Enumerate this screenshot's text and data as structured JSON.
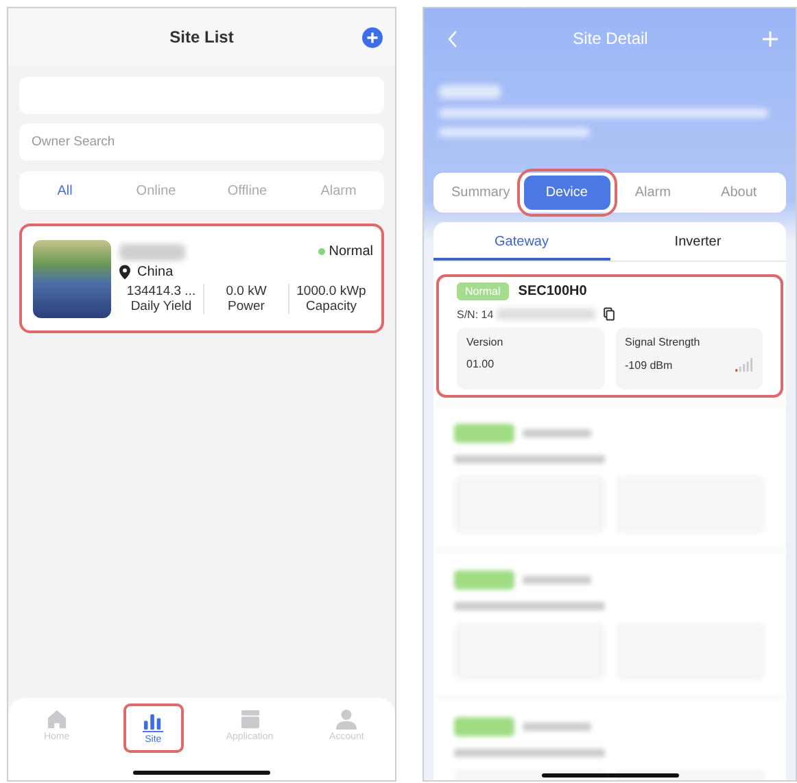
{
  "site_list": {
    "title": "Site List",
    "owner_search": {
      "placeholder": "Owner Search"
    },
    "filters": [
      {
        "label": "All",
        "selected": true
      },
      {
        "label": "Online",
        "selected": false
      },
      {
        "label": "Offline",
        "selected": false
      },
      {
        "label": "Alarm",
        "selected": false
      }
    ],
    "sites": [
      {
        "status": "Normal",
        "color": "#86d67e",
        "location": "China",
        "highlighted": true,
        "stats": [
          {
            "value": "134414.3 ...",
            "label": "Daily Yield"
          },
          {
            "value": "0.0 kW",
            "label": "Power"
          },
          {
            "value": "1000.0 kWp",
            "label": "Capacity"
          }
        ]
      }
    ],
    "nav": [
      {
        "kind": "home",
        "label": "Home",
        "selected": false,
        "highlighted": false
      },
      {
        "kind": "site",
        "label": "Site",
        "selected": true,
        "highlighted": true
      },
      {
        "kind": "application",
        "label": "Application",
        "selected": false,
        "highlighted": false
      },
      {
        "kind": "account",
        "label": "Account",
        "selected": false,
        "highlighted": false
      }
    ]
  },
  "site_detail": {
    "title": "Site Detail",
    "tabs": [
      {
        "label": "Summary",
        "selected": false,
        "highlighted": false
      },
      {
        "label": "Device",
        "selected": true,
        "highlighted": true
      },
      {
        "label": "Alarm",
        "selected": false,
        "highlighted": false
      },
      {
        "label": "About",
        "selected": false,
        "highlighted": false
      }
    ],
    "device_tabs": [
      {
        "label": "Gateway",
        "selected": true
      },
      {
        "label": "Inverter",
        "selected": false
      }
    ],
    "devices": [
      {
        "status": "Normal",
        "model": "SEC100H0",
        "serial": "S/N: 14",
        "highlighted": true,
        "fields": [
          {
            "kind": "version",
            "label": "Version",
            "value": "01.00"
          },
          {
            "kind": "signal",
            "label": "Signal Strength",
            "value": "-109 dBm"
          }
        ]
      }
    ]
  }
}
